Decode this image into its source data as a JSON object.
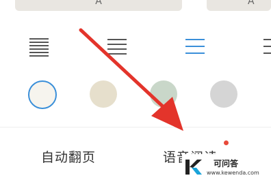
{
  "font_size_buttons": [
    {
      "label": "A"
    },
    {
      "label": "A"
    }
  ],
  "line_spacing_icons": [
    {
      "icon": "line-spacing-dense-icon",
      "selected": false
    },
    {
      "icon": "line-spacing-medium-icon",
      "selected": false
    },
    {
      "icon": "line-spacing-loose-icon",
      "selected": true
    },
    {
      "icon": "line-spacing-extra-icon",
      "selected": false
    }
  ],
  "background_swatches": [
    {
      "color": "#f6f4ee",
      "selected": true
    },
    {
      "color": "#e6dfcc",
      "selected": false
    },
    {
      "color": "#c9d7c9",
      "selected": false
    },
    {
      "color": "#d5d5d5",
      "selected": false
    }
  ],
  "bottom_options": {
    "auto_page_turn": "自动翻页",
    "voice_reading": "语音阅读"
  },
  "colors": {
    "accent": "#3a8fd9",
    "arrow": "#e3342b",
    "notification_dot": "#e84a3a"
  },
  "watermark": {
    "title": "可问答",
    "url": "www.kewenda.com"
  }
}
